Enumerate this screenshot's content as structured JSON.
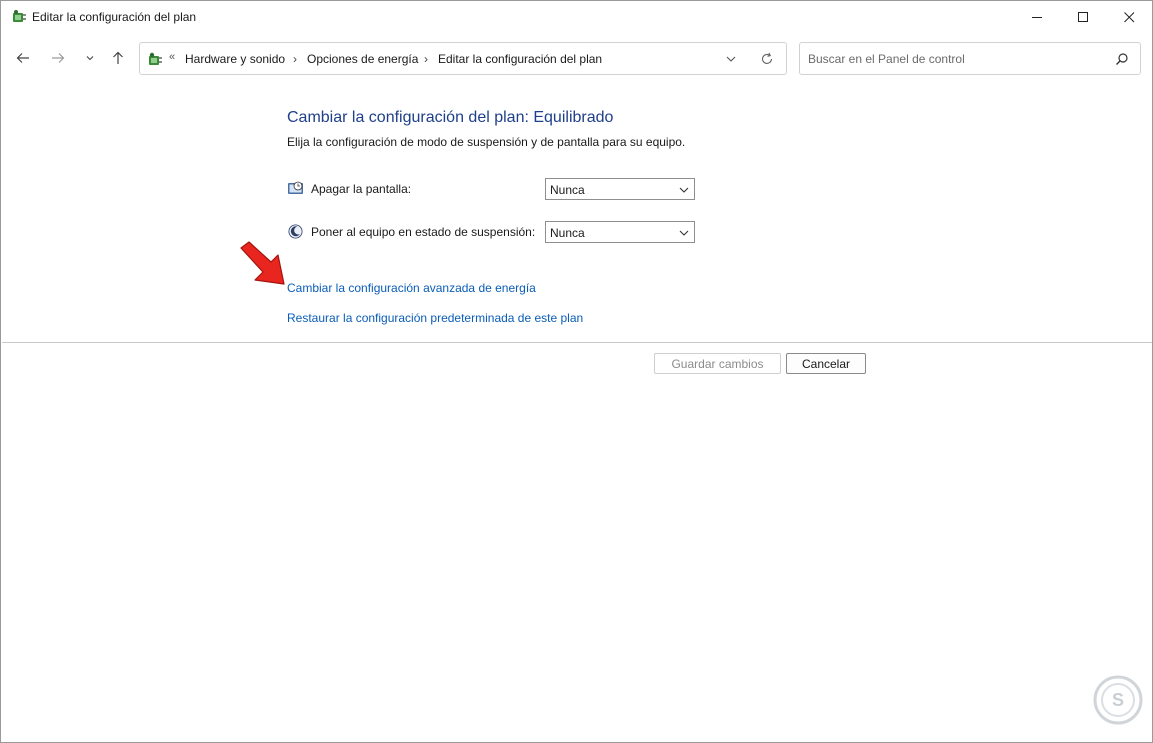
{
  "window": {
    "title": "Editar la configuración del plan",
    "title_icon": "power-options-icon"
  },
  "nav": {
    "breadcrumb": [
      "Hardware y sonido",
      "Opciones de energía",
      "Editar la configuración del plan"
    ],
    "search_placeholder": "Buscar en el Panel de control"
  },
  "main": {
    "heading": "Cambiar la configuración del plan: Equilibrado",
    "subheading": "Elija la configuración de modo de suspensión y de pantalla para su equipo.",
    "settings": [
      {
        "label": "Apagar la pantalla:",
        "value": "Nunca",
        "icon": "display-clock-icon"
      },
      {
        "label": "Poner al equipo en estado de suspensión:",
        "value": "Nunca",
        "icon": "sleep-moon-icon"
      }
    ],
    "links": {
      "advanced": "Cambiar la configuración avanzada de energía",
      "restore": "Restaurar la configuración predeterminada de este plan"
    }
  },
  "buttons": {
    "save": "Guardar cambios",
    "cancel": "Cancelar"
  },
  "colors": {
    "heading": "#1e3f8a",
    "link": "#0a5db8",
    "arrow": "#e8261f"
  }
}
